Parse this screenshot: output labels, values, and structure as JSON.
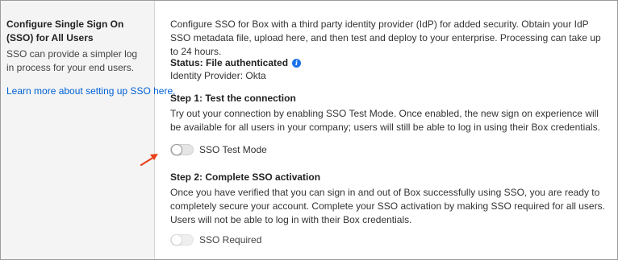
{
  "sidebar": {
    "title": "Configure Single Sign On (SSO) for All Users",
    "description": "SSO can provide a simpler log in process for your end users.",
    "link": "Learn more about setting up SSO here."
  },
  "main": {
    "intro": "Configure SSO for Box with a third party identity provider (IdP) for added security. Obtain your IdP SSO metadata file, upload here, and then test and deploy to your enterprise. Processing can take up to 24 hours.",
    "status": {
      "label": "Status: File authenticated",
      "identity_provider": "Identity Provider: Okta",
      "info_icon": "info-icon"
    },
    "step1": {
      "heading": "Step 1: Test the connection",
      "body": "Try out your connection by enabling SSO Test Mode. Once enabled, the new sign on experience will be available for all users in your company; users will still be able to log in using their Box credentials.",
      "toggle_label": "SSO Test Mode",
      "toggle_on": false
    },
    "step2": {
      "heading": "Step 2: Complete SSO activation",
      "body": "Once you have verified that you can sign in and out of Box successfully using SSO, you are ready to completely secure your account. Complete your SSO activation by making SSO required for all users. Users will not be able to log in with their Box credentials.",
      "toggle_label": "SSO Required",
      "toggle_on": false,
      "toggle_disabled": true
    }
  },
  "colors": {
    "link": "#0061d5",
    "arrow": "#e8401c",
    "info": "#1a73e8"
  }
}
